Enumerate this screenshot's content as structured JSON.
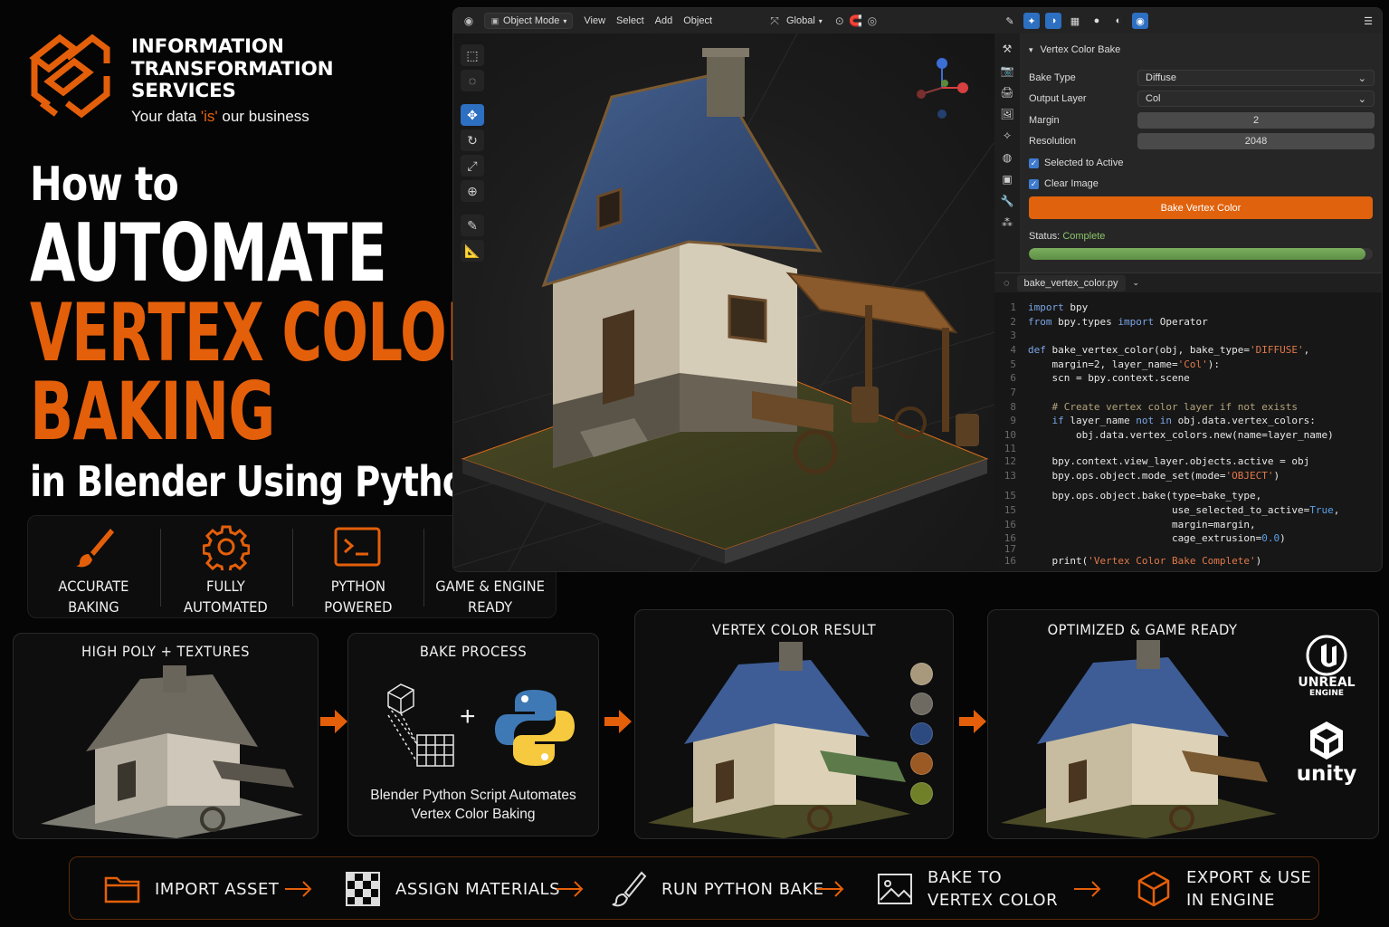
{
  "brand": {
    "name_line1": "INFORMATION",
    "name_line2": "TRANSFORMATION",
    "name_line3": "SERVICES",
    "tagline_pre": "Your data ",
    "tagline_hl": "'is'",
    "tagline_post": " our business",
    "accent_color": "#e8620c"
  },
  "headline": {
    "line1": "How to",
    "line2": "AUTOMATE",
    "line3": "VERTEX COLOR",
    "line4": "BAKING",
    "line5": "in Blender Using Python"
  },
  "features": [
    {
      "icon": "paint-brush-icon",
      "label": "ACCURATE\nBAKING"
    },
    {
      "icon": "gear-icon",
      "label": "FULLY\nAUTOMATED"
    },
    {
      "icon": "terminal-icon",
      "label": "PYTHON\nPOWERED"
    },
    {
      "icon": "cube-icon",
      "label": "GAME & ENGINE\nREADY"
    }
  ],
  "blender": {
    "header": {
      "mode": "Object Mode",
      "menu": [
        "View",
        "Select",
        "Add",
        "Object"
      ],
      "orientation": "Global"
    },
    "properties": {
      "panel_title": "Vertex Color Bake",
      "bake_type_label": "Bake Type",
      "bake_type_value": "Diffuse",
      "output_layer_label": "Output Layer",
      "output_layer_value": "Col",
      "margin_label": "Margin",
      "margin_value": "2",
      "resolution_label": "Resolution",
      "resolution_value": "2048",
      "selected_to_active_label": "Selected to Active",
      "selected_to_active": true,
      "clear_image_label": "Clear Image",
      "clear_image": true,
      "bake_button": "Bake Vertex Color",
      "status_label": "Status:",
      "status_value": "Complete",
      "progress": 0.98
    },
    "editor": {
      "filename": "bake_vertex_color.py",
      "lines": [
        {
          "n": "1",
          "tokens": [
            [
              "kw",
              "import"
            ],
            [
              "tx",
              " bpy"
            ]
          ]
        },
        {
          "n": "2",
          "tokens": [
            [
              "kw",
              "from"
            ],
            [
              "tx",
              " bpy.types "
            ],
            [
              "kw",
              "import"
            ],
            [
              "tx",
              " Operator"
            ]
          ]
        },
        {
          "n": "3",
          "tokens": []
        },
        {
          "n": "4",
          "tokens": [
            [
              "kw",
              "def"
            ],
            [
              "tx",
              " bake_vertex_color(obj, bake_type="
            ],
            [
              "st",
              "'DIFFUSE'"
            ],
            [
              "tx",
              ","
            ]
          ]
        },
        {
          "n": "5",
          "tokens": [
            [
              "tx",
              "    margin=2, layer_name="
            ],
            [
              "st",
              "'Col'"
            ],
            [
              "tx",
              "):"
            ]
          ]
        },
        {
          "n": "6",
          "tokens": [
            [
              "tx",
              "    scn = bpy.context.scene"
            ]
          ]
        },
        {
          "n": "7",
          "tokens": []
        },
        {
          "n": "8",
          "tokens": [
            [
              "cm",
              "    # Create vertex color layer if not exists"
            ]
          ]
        },
        {
          "n": "9",
          "tokens": [
            [
              "kw",
              "    if"
            ],
            [
              "tx",
              " layer_name "
            ],
            [
              "kw",
              "not in"
            ],
            [
              "tx",
              " obj.data.vertex_colors:"
            ]
          ]
        },
        {
          "n": "10",
          "tokens": [
            [
              "tx",
              "        obj.data.vertex_colors.new(name=layer_name)"
            ]
          ]
        },
        {
          "n": "11",
          "tokens": []
        },
        {
          "n": "12",
          "tokens": [
            [
              "tx",
              "    bpy.context.view_layer.objects.active = obj"
            ]
          ]
        },
        {
          "n": "13",
          "tokens": [
            [
              "tx",
              "    bpy.ops.object.mode_set(mode="
            ],
            [
              "st",
              "'OBJECT'"
            ],
            [
              "tx",
              ")"
            ]
          ]
        },
        {
          "n": "14",
          "tokens": []
        },
        {
          "n": "15",
          "tokens": [
            [
              "tx",
              "    bpy.ops.object.bake(type=bake_type,"
            ]
          ]
        },
        {
          "n": "15",
          "tokens": [
            [
              "tx",
              "                        use_selected_to_active="
            ],
            [
              "bl",
              "True"
            ],
            [
              "tx",
              ","
            ]
          ]
        },
        {
          "n": "16",
          "tokens": [
            [
              "tx",
              "                        margin=margin,"
            ]
          ]
        },
        {
          "n": "16",
          "tokens": [
            [
              "tx",
              "                        cage_extrusion="
            ],
            [
              "bl",
              "0.0"
            ],
            [
              "tx",
              ")"
            ]
          ]
        },
        {
          "n": "17",
          "tokens": []
        },
        {
          "n": "16",
          "tokens": [
            [
              "tx",
              "    print("
            ],
            [
              "st",
              "'Vertex Color Bake Complete'"
            ],
            [
              "tx",
              ")"
            ]
          ]
        }
      ]
    }
  },
  "pipeline": {
    "panel1_title": "HIGH POLY + TEXTURES",
    "panel2_title": "BAKE PROCESS",
    "panel2_caption": "Blender Python Script Automates\nVertex Color Baking",
    "panel3_title": "VERTEX COLOR RESULT",
    "panel4_title": "OPTIMIZED & GAME READY",
    "swatches": [
      "#a8997c",
      "#6e6a62",
      "#2c4a80",
      "#9b5a24",
      "#6f8028"
    ],
    "engine1_line1": "UNREAL",
    "engine1_line2": "ENGINE",
    "engine2": "unity"
  },
  "steps": [
    {
      "icon": "folder-icon",
      "label": "IMPORT ASSET"
    },
    {
      "icon": "checker-icon",
      "label": "ASSIGN MATERIALS"
    },
    {
      "icon": "brush-icon",
      "label": "RUN PYTHON BAKE"
    },
    {
      "icon": "image-icon",
      "label": "BAKE TO\nVERTEX COLOR"
    },
    {
      "icon": "cube-icon",
      "label": "EXPORT & USE\nIN ENGINE"
    }
  ]
}
